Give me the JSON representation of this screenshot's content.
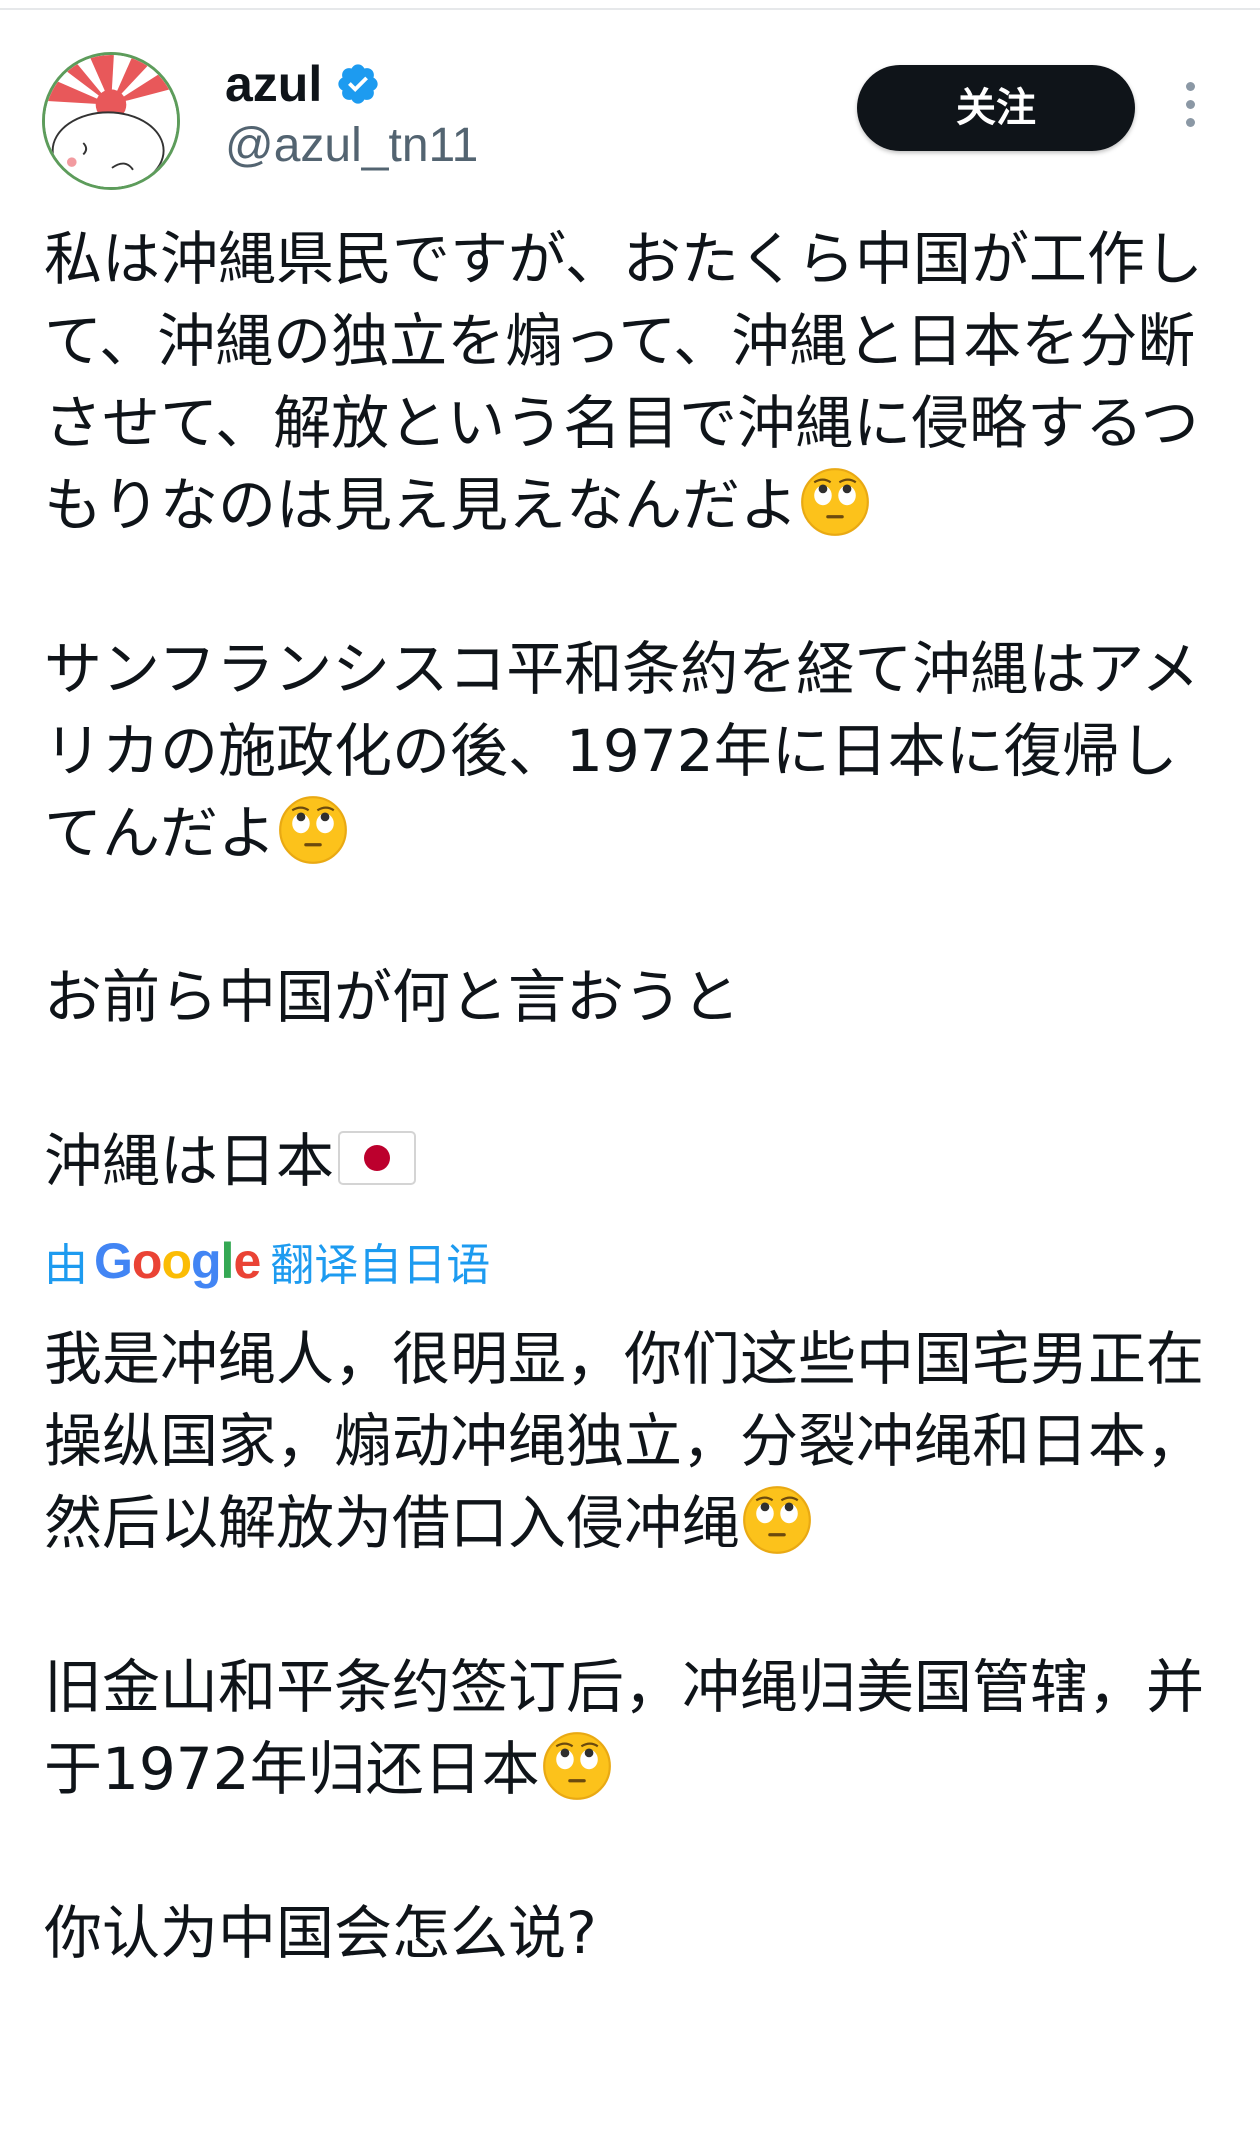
{
  "header": {
    "display_name": "azul",
    "handle": "@azul_tn11",
    "follow_label": "关注"
  },
  "post": {
    "original": {
      "para1": "私は沖縄県民ですが、おたくら中国が工作して、沖縄の独立を煽って、沖縄と日本を分断させて、解放という名目で沖縄に侵略するつもりなのは見え見えなんだよ",
      "para2": "サンフランシスコ平和条約を経て沖縄はアメリカの施政化の後、1972年に日本に復帰してんだよ",
      "para3": "お前ら中国が何と言おうと",
      "para4": "沖縄は日本"
    },
    "translation_label": {
      "prefix": "由",
      "brand": "Google",
      "suffix": "翻译自日语"
    },
    "translated": {
      "para1": "我是冲绳人，很明显，你们这些中国宅男正在操纵国家，煽动冲绳独立，分裂冲绳和日本，然后以解放为借口入侵冲绳",
      "para2": "旧金山和平条约签订后，冲绳归美国管辖，并于1972年归还日本",
      "para3": "你认为中国会怎么说?"
    }
  },
  "icons": {
    "verified": "verified-badge-icon",
    "more": "more-vertical-icon",
    "emoji": "face-with-rolling-eyes-emoji",
    "flag": "japan-flag-emoji"
  },
  "colors": {
    "text": "#0f1419",
    "handle": "#536471",
    "link": "#1d9bf0",
    "follow_bg": "#0f1419",
    "verified": "#1d9bf0"
  }
}
